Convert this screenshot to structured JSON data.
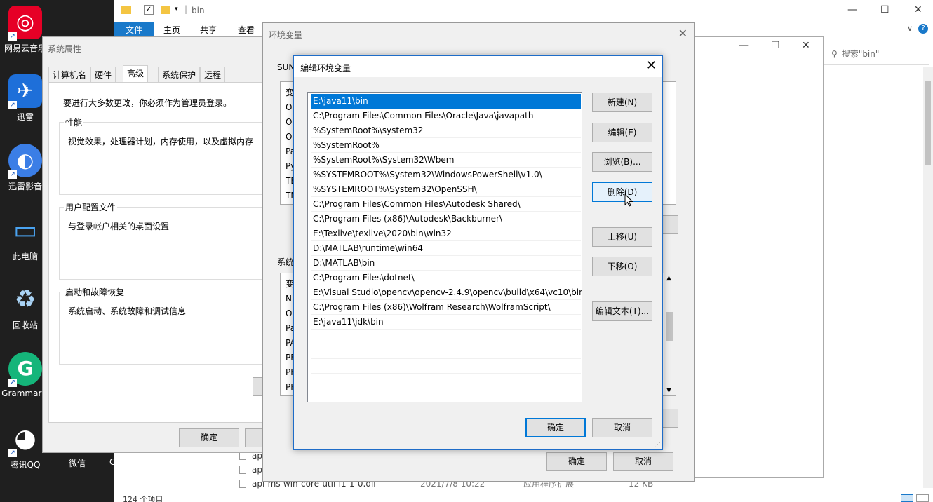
{
  "desktop": {
    "icons": [
      {
        "label": "网易云音乐",
        "color": "#e60026",
        "glyph": "◎"
      },
      {
        "label": "迅雷",
        "color": "#1e6fd9",
        "glyph": "✈"
      },
      {
        "label": "迅雷影音",
        "color": "#3b7ee6",
        "glyph": "◐"
      },
      {
        "label": "此电脑",
        "color": "#2a8fe0",
        "glyph": "▭"
      },
      {
        "label": "回收站",
        "color": "#6aa6d8",
        "glyph": "♻"
      },
      {
        "label": "Grammarly",
        "color": "#15b57a",
        "glyph": "G"
      },
      {
        "label": "腾讯QQ",
        "color": "#222222",
        "glyph": "◕"
      }
    ],
    "bottom_labels": [
      "微信",
      "C"
    ]
  },
  "explorer": {
    "title": "bin",
    "ribbon_tabs": [
      "文件",
      "主页",
      "共享",
      "查看"
    ],
    "search_placeholder": "搜索\"bin\"",
    "files": [
      {
        "name": "api",
        "date": "",
        "type": "",
        "size": ""
      },
      {
        "name": "api",
        "date": "",
        "type": "",
        "size": ""
      },
      {
        "name": "api-ms-win-core-util-l1-1-0.dll",
        "date": "2021/7/8 10:22",
        "type": "应用程序扩展",
        "size": "12 KB"
      }
    ],
    "status": "124 个项目"
  },
  "sysprops": {
    "title": "系统属性",
    "tabs": [
      "计算机名",
      "硬件",
      "高级",
      "系统保护",
      "远程"
    ],
    "active_tab": "高级",
    "notice": "要进行大多数更改，你必须作为管理员登录。",
    "groups": [
      {
        "label": "性能",
        "text": "视觉效果，处理器计划，内存使用，以及虚拟内存"
      },
      {
        "label": "用户配置文件",
        "text": "与登录帐户相关的桌面设置"
      },
      {
        "label": "启动和故障恢复",
        "text": "系统启动、系统故障和调试信息"
      }
    ],
    "ok_label": "确定"
  },
  "envvars": {
    "title": "环境变量",
    "user_section": "SUN",
    "user_rows": [
      "变",
      "O",
      "O",
      "O",
      "Pa",
      "Py",
      "TE",
      "TN"
    ],
    "system_section": "系统",
    "system_rows": [
      "变",
      "N",
      "O",
      "Pa",
      "PA",
      "PF",
      "PF",
      "PF"
    ],
    "ok_label": "确定",
    "cancel_label": "取消"
  },
  "editdlg": {
    "title": "编辑环境变量",
    "paths": [
      "E:\\java11\\bin",
      "C:\\Program Files\\Common Files\\Oracle\\Java\\javapath",
      "%SystemRoot%\\system32",
      "%SystemRoot%",
      "%SystemRoot%\\System32\\Wbem",
      "%SYSTEMROOT%\\System32\\WindowsPowerShell\\v1.0\\",
      "%SYSTEMROOT%\\System32\\OpenSSH\\",
      "C:\\Program Files\\Common Files\\Autodesk Shared\\",
      "C:\\Program Files (x86)\\Autodesk\\Backburner\\",
      "E:\\Texlive\\texlive\\2020\\bin\\win32",
      "D:\\MATLAB\\runtime\\win64",
      "D:\\MATLAB\\bin",
      "C:\\Program Files\\dotnet\\",
      "E:\\Visual Studio\\opencv\\opencv-2.4.9\\opencv\\build\\x64\\vc10\\bin",
      "C:\\Program Files (x86)\\Wolfram Research\\WolframScript\\",
      "E:\\java11\\jdk\\bin"
    ],
    "selected_index": 0,
    "buttons": {
      "new": "新建(N)",
      "edit": "编辑(E)",
      "browse": "浏览(B)...",
      "delete": "删除(D)",
      "up": "上移(U)",
      "down": "下移(O)",
      "edit_text": "编辑文本(T)..."
    },
    "ok_label": "确定",
    "cancel_label": "取消"
  }
}
